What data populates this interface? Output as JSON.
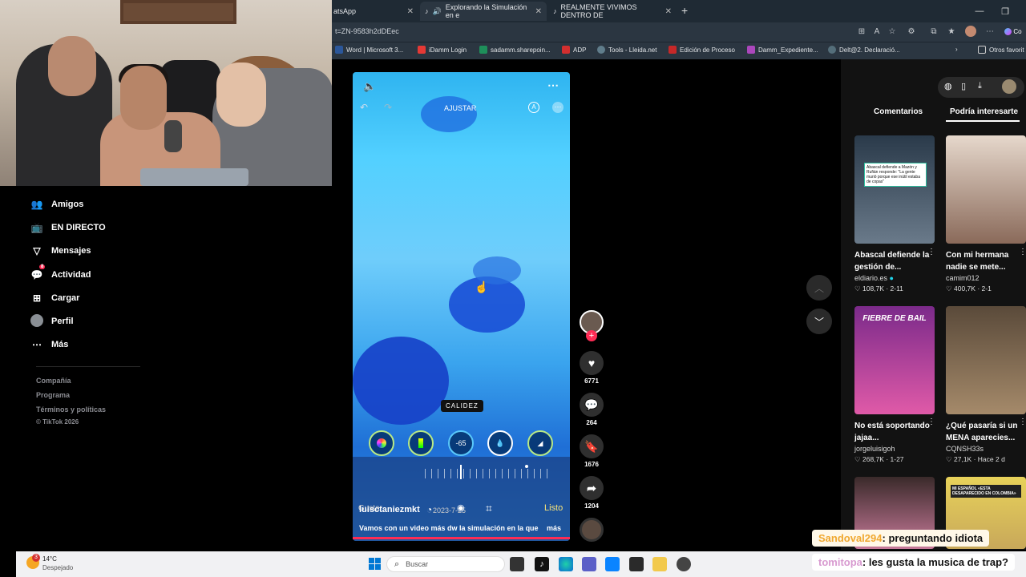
{
  "browser": {
    "tabs": [
      {
        "label": "atsApp"
      },
      {
        "label": "Explorando la Simulación en e"
      },
      {
        "label": "REALMENTE VIVIMOS DENTRO DE"
      }
    ],
    "new_tab": "+",
    "url": "t=ZN-9583h2dDEec",
    "bookmarks": [
      {
        "label": "Word | Microsoft 3...",
        "color": "#2b579a"
      },
      {
        "label": "iDamm Login",
        "color": "#e53935"
      },
      {
        "label": "sadamm.sharepoin...",
        "color": "#1e8f5a"
      },
      {
        "label": "ADP",
        "color": "#d32f2f"
      },
      {
        "label": "Tools - Lleida.net",
        "color": "#607d8b"
      },
      {
        "label": "Edición de Proceso",
        "color": "#c62828"
      },
      {
        "label": "Damm_Expediente...",
        "color": "#ab47bc"
      },
      {
        "label": "Delt@2. Declaració...",
        "color": "#546e7a"
      }
    ],
    "other_favorites": "Otros favorit",
    "profile_initial": "Co"
  },
  "sidebar": {
    "items": [
      {
        "label": "Amigos",
        "icon": "friends-icon"
      },
      {
        "label": "EN DIRECTO",
        "icon": "live-icon"
      },
      {
        "label": "Mensajes",
        "icon": "messages-icon"
      },
      {
        "label": "Actividad",
        "icon": "activity-icon",
        "badge": "8"
      },
      {
        "label": "Cargar",
        "icon": "upload-icon"
      },
      {
        "label": "Perfil",
        "icon": "profile-icon"
      },
      {
        "label": "Más",
        "icon": "more-icon"
      }
    ],
    "footer": [
      "Compañía",
      "Programa",
      "Términos y políticas",
      "© TikTok 2026"
    ]
  },
  "video": {
    "edit_title": "AJUSTAR",
    "warmth_label": "CALIDEZ",
    "warmth_value": "-65",
    "done": "Listo",
    "overlay_text": "Gustar",
    "author": "luisctaniezmkt",
    "date": "2023-7-25",
    "description": "Vamos con un video más dw la simulación en la que",
    "more": "más"
  },
  "actions": {
    "likes": "6771",
    "comments": "264",
    "saves": "1676",
    "shares": "1204"
  },
  "right_panel": {
    "tabs": [
      "Comentarios",
      "Podría interesarte"
    ],
    "cards": [
      {
        "title": "Abascal defiende la gestión de...",
        "author": "eldiario.es",
        "verified": true,
        "likes": "108,7K",
        "date": "2-11",
        "thumb_text": "Abascal defiende a Mazón y Rufián responde: \"La gente murió porque ese inútil estaba de copas\"",
        "colors": [
          "#2a3a4a",
          "#6a7a8a"
        ]
      },
      {
        "title": "Con mi hermana nadie se mete...",
        "author": "camim012",
        "verified": false,
        "likes": "400,7K",
        "date": "2-1",
        "thumb_text": "",
        "colors": [
          "#d9c8bd",
          "#8a6a5a"
        ]
      },
      {
        "title": "No está soportando jajaa...",
        "author": "jorgeluisigoh",
        "verified": false,
        "likes": "268,7K",
        "date": "1-27",
        "thumb_text": "FIEBRE DE BAIL",
        "colors": [
          "#7b2a8a",
          "#e05aa8"
        ]
      },
      {
        "title": "¿Qué pasaría si un MENA aparecies...",
        "author": "CQNSH33s",
        "verified": false,
        "likes": "27,1K",
        "date": "Hace 2 d",
        "thumb_text": "",
        "colors": [
          "#6b5a4a",
          "#a58a6a"
        ]
      },
      {
        "title": "",
        "author": "",
        "verified": false,
        "likes": "",
        "date": "",
        "thumb_text": "",
        "colors": [
          "#3a2a2a",
          "#c87a9a"
        ]
      },
      {
        "title": "",
        "author": "",
        "verified": false,
        "likes": "",
        "date": "",
        "thumb_text": "MI ESPAÑOL «ESTA DESAPARECIDO EN COLOMBIA»",
        "colors": [
          "#e8d25a",
          "#c8a85a"
        ]
      }
    ]
  },
  "taskbar": {
    "weather_temp": "14°C",
    "weather_desc": "Despejado",
    "weather_badge": "3",
    "search_placeholder": "Buscar"
  },
  "chat": [
    {
      "user": "Sandoval294",
      "message": ": preguntando idiota",
      "user_color": "#f0a830"
    },
    {
      "user": "tomitopa",
      "message": ": les gusta la musica de trap?",
      "user_color": "#e7a8e0"
    }
  ]
}
